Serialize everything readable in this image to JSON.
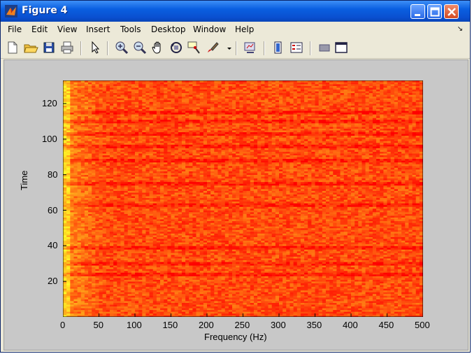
{
  "window": {
    "title": "Figure 4",
    "icon": "matlab-icon"
  },
  "menu": [
    "File",
    "Edit",
    "View",
    "Insert",
    "Tools",
    "Desktop",
    "Window",
    "Help"
  ],
  "toolbar_icons": [
    "new-figure-icon",
    "open-file-icon",
    "save-icon",
    "print-icon",
    "edit-plot-arrow-icon",
    "zoom-in-icon",
    "zoom-out-icon",
    "pan-hand-icon",
    "rotate-3d-icon",
    "data-cursor-icon",
    "brush-icon",
    "link-plot-icon",
    "colorbar-icon",
    "legend-icon",
    "hide-plot-tools-icon",
    "show-plot-tools-icon"
  ],
  "chart_data": {
    "type": "heatmap",
    "title": "",
    "xlabel": "Frequency (Hz)",
    "ylabel": "Time",
    "xlim": [
      0,
      500
    ],
    "ylim": [
      0,
      133
    ],
    "xticks": [
      0,
      50,
      100,
      150,
      200,
      250,
      300,
      350,
      400,
      450,
      500
    ],
    "yticks": [
      20,
      40,
      60,
      80,
      100,
      120
    ],
    "colormap": "autumn (yellow to red)",
    "colors": {
      "low": "#ffff3a",
      "mid": "#ff9a2a",
      "high": "#e8281e"
    },
    "prominent_rows": [
      24,
      30,
      39,
      63,
      75,
      88,
      96,
      103,
      110,
      115
    ]
  }
}
